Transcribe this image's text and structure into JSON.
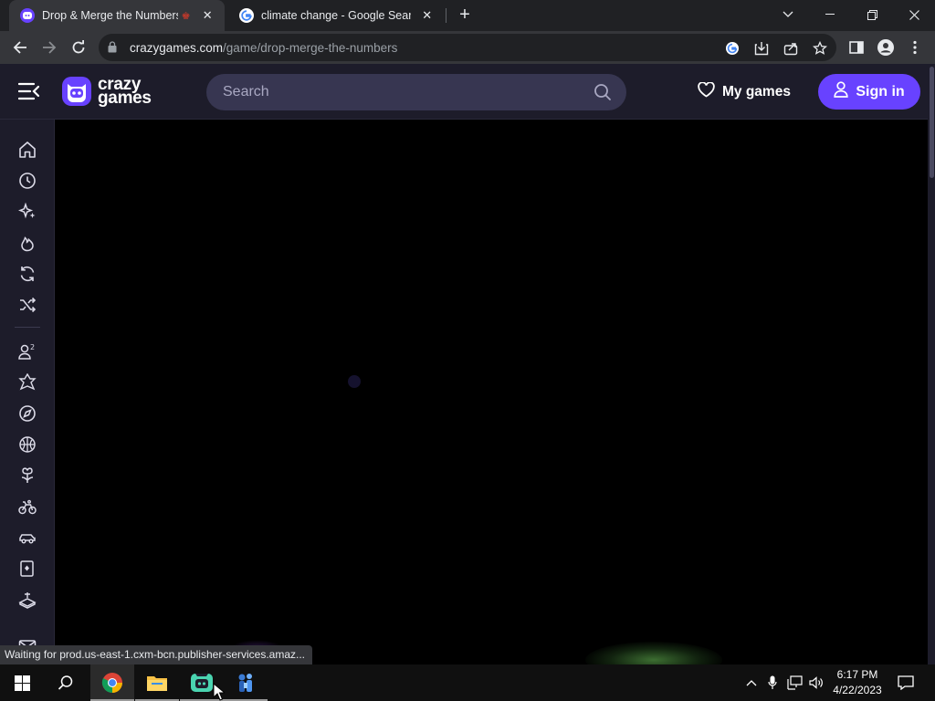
{
  "browser": {
    "tabs": [
      {
        "title": "Drop & Merge the Numbers",
        "active": true,
        "favicon": "crazygames-icon"
      },
      {
        "title": "climate change - Google Search",
        "active": false,
        "favicon": "google-icon"
      }
    ],
    "new_tab_symbol": "+",
    "url_host": "crazygames.com",
    "url_path": "/game/drop-merge-the-numbers",
    "status_text": "Waiting for prod.us-east-1.cxm-bcn.publisher-services.amaz..."
  },
  "site": {
    "logo_line1": "crazy",
    "logo_line2": "games",
    "search_placeholder": "Search",
    "my_games_label": "My games",
    "sign_in_label": "Sign in",
    "brand_color": "#6842ff",
    "header_color": "#1d1c2a",
    "sidebar_icons": [
      "home-icon",
      "recent-icon",
      "new-icon",
      "trending-icon",
      "updated-icon",
      "random-icon",
      "multiplayer-icon",
      "action-icon",
      "adventure-icon",
      "basketball-icon",
      "casual-icon",
      "bike-icon",
      "car-icon",
      "card-icon",
      "controller-icon",
      "mail-icon"
    ]
  },
  "taskbar": {
    "time": "6:17 PM",
    "date": "4/22/2023",
    "apps": [
      "chrome-icon",
      "file-explorer-icon",
      "crazygames-app-icon",
      "network-app-icon"
    ]
  }
}
